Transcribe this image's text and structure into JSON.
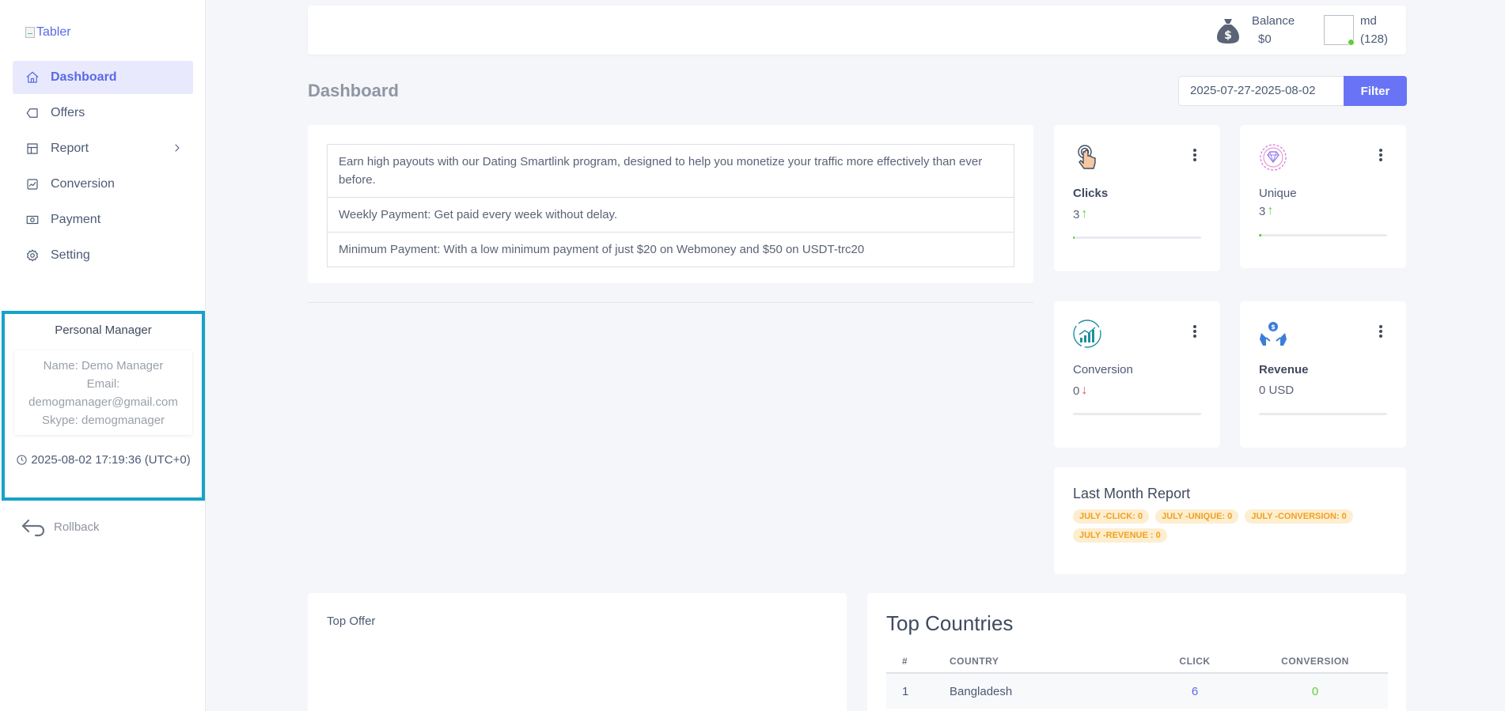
{
  "sidebar": {
    "logo_alt": "Tabler",
    "items": [
      {
        "label": "Dashboard",
        "icon": "home-icon",
        "active": true
      },
      {
        "label": "Offers",
        "icon": "tag-icon"
      },
      {
        "label": "Report",
        "icon": "layout-icon",
        "has_submenu": true
      },
      {
        "label": "Conversion",
        "icon": "chart-line-icon"
      },
      {
        "label": "Payment",
        "icon": "cash-icon"
      },
      {
        "label": "Setting",
        "icon": "gear-icon"
      }
    ],
    "manager": {
      "title": "Personal Manager",
      "name": "Name: Demo Manager",
      "email_label": "Email:",
      "email": "demogmanager@gmail.com",
      "skype": "Skype: demogmanager",
      "time": "2025-08-02 17:19:36 (UTC+0)"
    },
    "rollback": "Rollback"
  },
  "header": {
    "balance_label": "Balance",
    "balance_value": "$0",
    "user_name": "md",
    "user_count": "(128)"
  },
  "page": {
    "title": "Dashboard",
    "date_range": "2025-07-27-2025-08-02",
    "filter_label": "Filter"
  },
  "info": {
    "rows": [
      "Earn high payouts with our Dating Smartlink program, designed to help you monetize your traffic more effectively than ever before.",
      "Weekly Payment: Get paid every week without delay.",
      "Minimum Payment: With a low minimum payment of just $20 on Webmoney and $50 on USDT-trc20"
    ]
  },
  "stats": {
    "clicks": {
      "label": "Clicks",
      "value": "3",
      "trend": "up",
      "progress": 0.01
    },
    "unique": {
      "label": "Unique",
      "value": "3",
      "trend": "up",
      "progress": 0.02
    },
    "conversion": {
      "label": "Conversion",
      "value": "0",
      "trend": "down",
      "progress": 0
    },
    "revenue": {
      "label": "Revenue",
      "value": "0 USD",
      "progress": 0
    }
  },
  "last_month": {
    "title": "Last Month Report",
    "badges": [
      "JULY -CLICK: 0",
      "JULY -UNIQUE: 0",
      "JULY -CONVERSION: 0",
      "JULY -REVENUE : 0"
    ]
  },
  "top_offer": {
    "title": "Top Offer"
  },
  "top_countries": {
    "title": "Top Countries",
    "headers": [
      "#",
      "COUNTRY",
      "CLICK",
      "CONVERSION"
    ],
    "rows": [
      {
        "rank": "1",
        "country": "Bangladesh",
        "click": "6",
        "conversion": "0"
      }
    ]
  },
  "colors": {
    "accent": "#6874f5",
    "manager_border": "#16a2c8",
    "success": "#5fcf3a",
    "danger": "#e84a4a",
    "badge_bg": "#fdeecf",
    "badge_text": "#f0a020"
  },
  "arrows": {
    "up": "↑",
    "down": "↓"
  }
}
